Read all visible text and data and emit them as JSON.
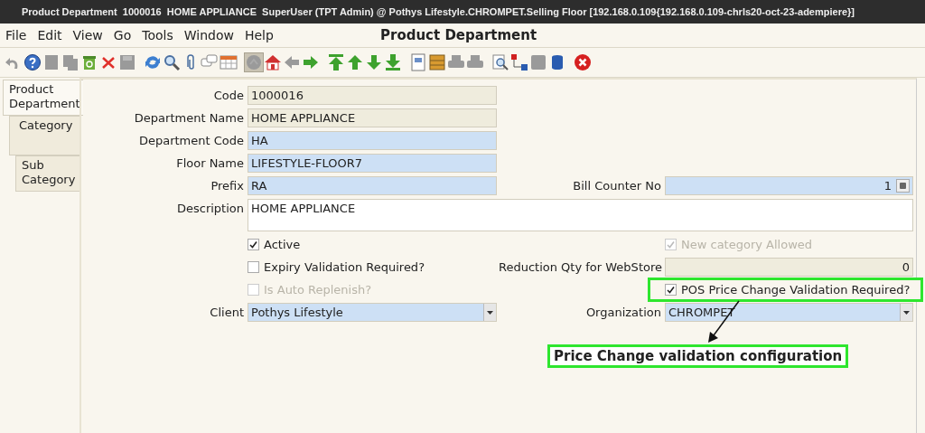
{
  "window": {
    "title": "Product Department  1000016  HOME APPLIANCE  SuperUser (TPT Admin) @ Pothys Lifestyle.CHROMPET.Selling Floor [192.168.0.109{192.168.0.109-chrls20-oct-23-adempiere}]"
  },
  "menu": [
    "File",
    "Edit",
    "View",
    "Go",
    "Tools",
    "Window",
    "Help"
  ],
  "screen_title": "Product Department",
  "toolbar": [
    [
      {
        "kind": "undo",
        "disabled": true,
        "pressed": false
      },
      {
        "kind": "help",
        "disabled": false,
        "pressed": false
      },
      {
        "kind": "new",
        "disabled": true,
        "pressed": false
      },
      {
        "kind": "copy",
        "disabled": true,
        "pressed": false
      },
      {
        "kind": "bin",
        "disabled": false,
        "pressed": false
      },
      {
        "kind": "delete",
        "disabled": false,
        "pressed": false
      },
      {
        "kind": "save",
        "disabled": true,
        "pressed": false
      }
    ],
    [
      {
        "kind": "refresh",
        "disabled": false,
        "pressed": false
      },
      {
        "kind": "find",
        "disabled": false,
        "pressed": false
      },
      {
        "kind": "attach",
        "disabled": false,
        "pressed": false
      },
      {
        "kind": "chat",
        "disabled": false,
        "pressed": false
      },
      {
        "kind": "grid",
        "disabled": false,
        "pressed": false
      }
    ],
    [
      {
        "kind": "history",
        "disabled": true,
        "pressed": true
      },
      {
        "kind": "home",
        "disabled": false,
        "pressed": false
      },
      {
        "kind": "back",
        "disabled": true,
        "pressed": false
      },
      {
        "kind": "forward",
        "disabled": false,
        "pressed": false
      }
    ],
    [
      {
        "kind": "first",
        "disabled": false,
        "pressed": false
      },
      {
        "kind": "up",
        "disabled": false,
        "pressed": false
      },
      {
        "kind": "down",
        "disabled": false,
        "pressed": false
      },
      {
        "kind": "last",
        "disabled": false,
        "pressed": false
      }
    ],
    [
      {
        "kind": "report",
        "disabled": false,
        "pressed": false
      },
      {
        "kind": "archive",
        "disabled": false,
        "pressed": false
      },
      {
        "kind": "print",
        "disabled": true,
        "pressed": false
      },
      {
        "kind": "print",
        "disabled": true,
        "pressed": false
      }
    ],
    [
      {
        "kind": "zoom",
        "disabled": false,
        "pressed": false
      },
      {
        "kind": "workflow",
        "disabled": false,
        "pressed": false
      },
      {
        "kind": "tile",
        "disabled": true,
        "pressed": false
      },
      {
        "kind": "db",
        "disabled": false,
        "pressed": false
      }
    ],
    [
      {
        "kind": "close",
        "disabled": false,
        "pressed": false
      }
    ]
  ],
  "tabs": [
    {
      "label": "Product Department",
      "selected": true
    },
    {
      "label": "Category",
      "selected": false
    },
    {
      "label": "Sub Category",
      "selected": false
    }
  ],
  "rows": [
    {
      "left": {
        "kind": "text",
        "label": "Code",
        "value": "1000016",
        "readonly": true
      }
    },
    {
      "left": {
        "kind": "text",
        "label": "Department Name",
        "value": "HOME APPLIANCE",
        "readonly": true
      }
    },
    {
      "left": {
        "kind": "text",
        "label": "Department Code",
        "value": "HA",
        "readonly": false
      }
    },
    {
      "left": {
        "kind": "text",
        "label": "Floor Name",
        "value": "LIFESTYLE-FLOOR7",
        "readonly": false
      }
    },
    {
      "left": {
        "kind": "text",
        "label": "Prefix",
        "value": "RA",
        "readonly": false
      },
      "right": {
        "kind": "number",
        "label": "Bill Counter No",
        "value": "1",
        "readonly": false
      }
    },
    {
      "left": {
        "kind": "textarea",
        "label": "Description",
        "value": "HOME APPLIANCE"
      }
    },
    {
      "left": {
        "kind": "checkbox",
        "label": "Active",
        "checked": true,
        "disabled": false,
        "highlighted": false
      },
      "right": {
        "kind": "checkbox",
        "label": "New category Allowed",
        "checked": true,
        "disabled": true,
        "highlighted": false
      }
    },
    {
      "left": {
        "kind": "checkbox",
        "label": "Expiry Validation Required?",
        "checked": false,
        "disabled": false,
        "highlighted": false
      },
      "right": {
        "kind": "number",
        "label": "Reduction Qty for WebStore",
        "value": "0",
        "readonly": true
      }
    },
    {
      "left": {
        "kind": "checkbox",
        "label": "Is Auto Replenish?",
        "checked": false,
        "disabled": true,
        "highlighted": false
      },
      "right": {
        "kind": "checkbox",
        "label": "POS Price Change Validation Required?",
        "checked": true,
        "disabled": false,
        "highlighted": true
      }
    },
    {
      "left": {
        "kind": "select",
        "label": "Client",
        "value": "Pothys Lifestyle"
      },
      "right": {
        "kind": "select",
        "label": "Organization",
        "value": "CHROMPET"
      }
    }
  ],
  "annotation": {
    "text": "Price Change validation configuration"
  }
}
